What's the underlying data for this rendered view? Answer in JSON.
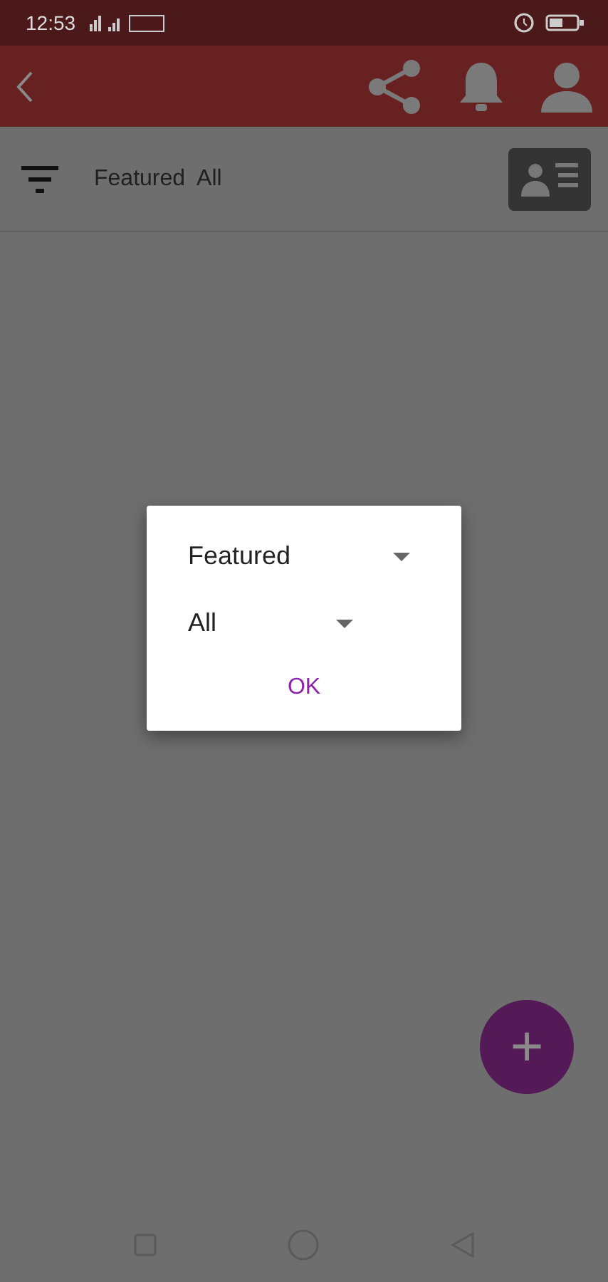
{
  "status_bar": {
    "time": "12:53"
  },
  "filter_bar": {
    "labels": [
      "Featured",
      "All"
    ]
  },
  "dialog": {
    "dropdowns": [
      {
        "value": "Featured"
      },
      {
        "value": "All"
      }
    ],
    "button": "OK"
  },
  "fab": {
    "label": "+"
  }
}
